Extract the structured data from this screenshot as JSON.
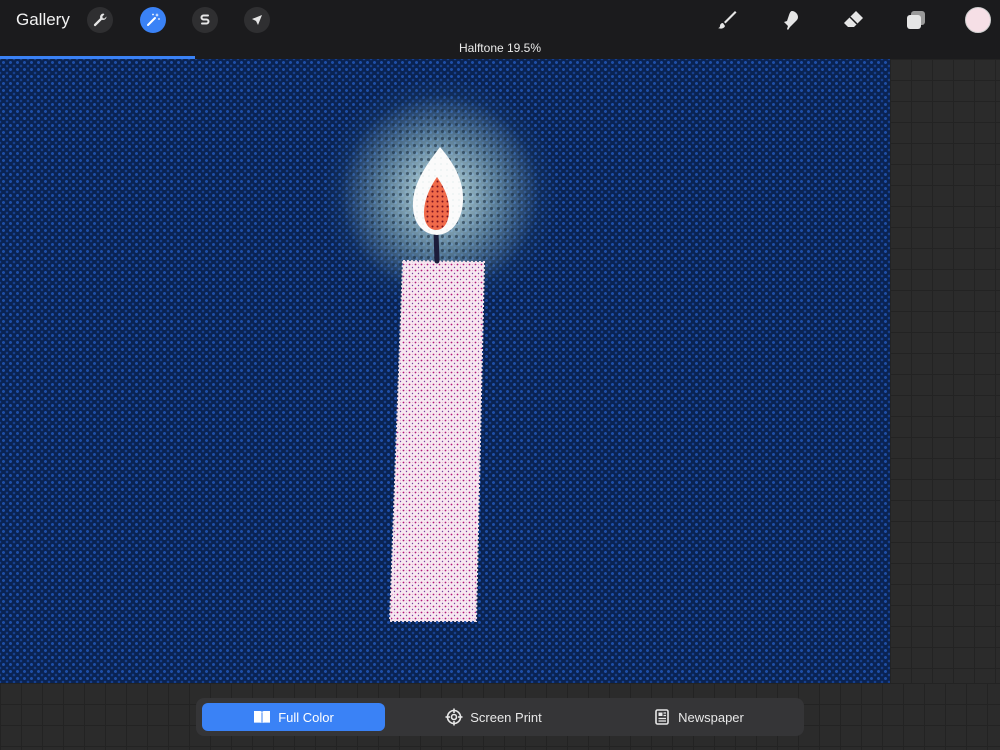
{
  "toolbar": {
    "gallery_label": "Gallery",
    "left_tools": [
      {
        "name": "actions",
        "icon": "wrench-icon",
        "active": false
      },
      {
        "name": "adjustments",
        "icon": "magic-wand-icon",
        "active": true
      },
      {
        "name": "selection",
        "icon": "selection-s-icon",
        "active": false
      },
      {
        "name": "transform",
        "icon": "arrow-cursor-icon",
        "active": false
      }
    ],
    "right_tools": [
      {
        "name": "brush",
        "icon": "brush-icon"
      },
      {
        "name": "smudge",
        "icon": "smudge-icon"
      },
      {
        "name": "eraser",
        "icon": "eraser-icon"
      },
      {
        "name": "layers",
        "icon": "layers-icon"
      }
    ],
    "current_color": "#f6dfe6"
  },
  "status": {
    "label": "Halftone 19.5%",
    "progress": 0.195,
    "accent": "#3a82f6"
  },
  "canvas": {
    "background_color": "#0a2352",
    "subject": "candle-illustration"
  },
  "halftone_modes": {
    "selected": "Full Color",
    "options": [
      {
        "label": "Full Color",
        "icon": "book-icon",
        "active": true
      },
      {
        "label": "Screen Print",
        "icon": "crosshair-icon",
        "active": false
      },
      {
        "label": "Newspaper",
        "icon": "newspaper-icon",
        "active": false
      }
    ]
  }
}
